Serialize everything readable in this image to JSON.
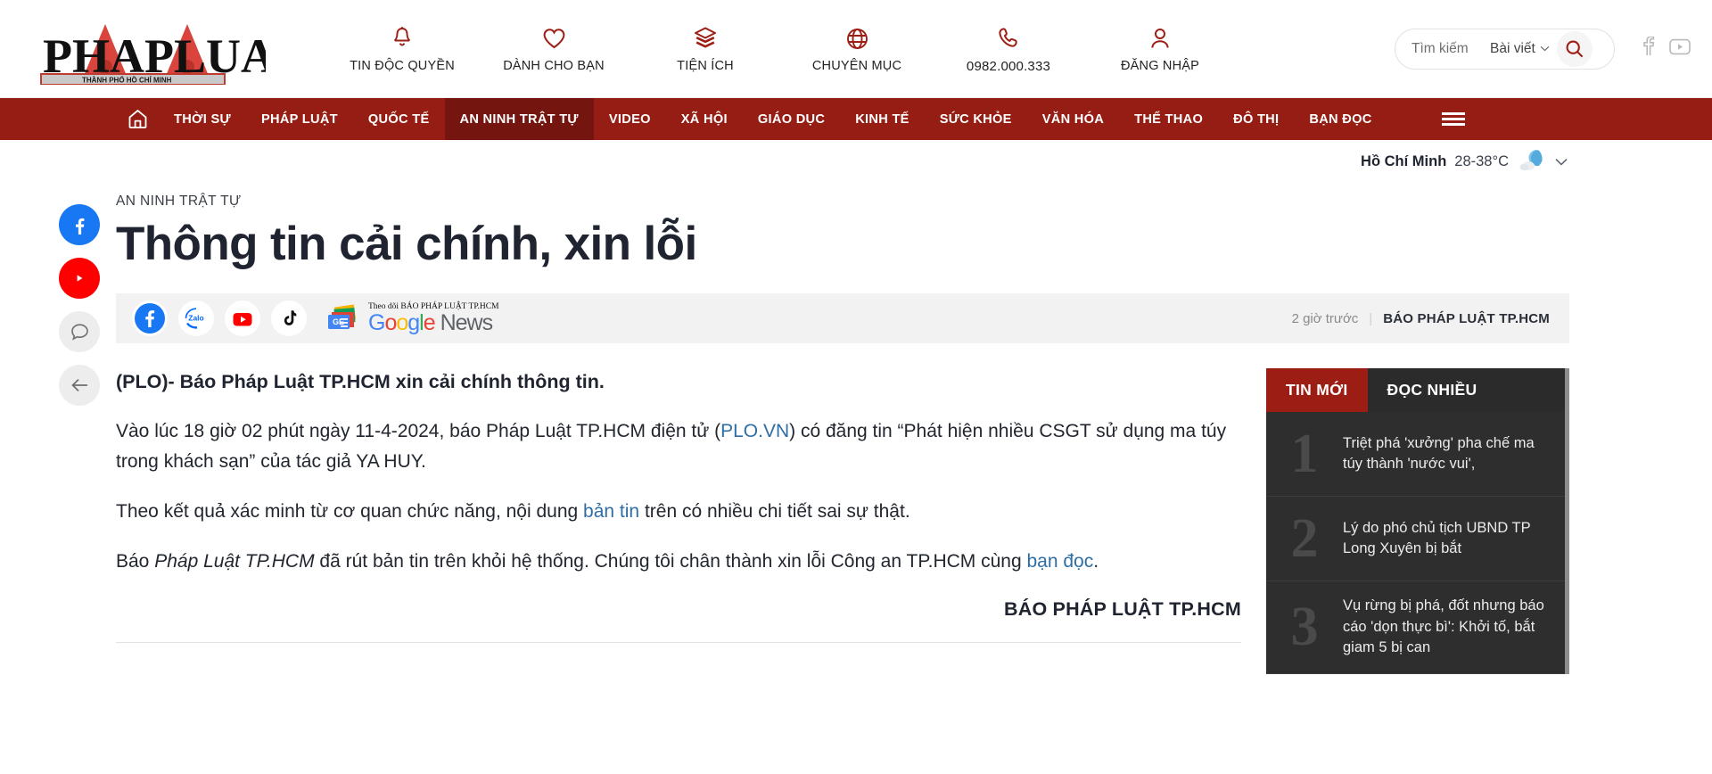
{
  "header": {
    "logo_main": "PHAPLUAT",
    "logo_sub": "THÀNH PHỐ HỒ CHÍ MINH",
    "nav_items": [
      {
        "label": "TIN ĐỘC QUYỀN",
        "icon": "bell-icon"
      },
      {
        "label": "DÀNH CHO BẠN",
        "icon": "heart-icon"
      },
      {
        "label": "TIỆN ÍCH",
        "icon": "layers-icon"
      },
      {
        "label": "CHUYÊN MỤC",
        "icon": "globe-icon"
      },
      {
        "label": "0982.000.333",
        "icon": "phone-icon"
      },
      {
        "label": "ĐĂNG NHẬP",
        "icon": "user-icon"
      }
    ],
    "search": {
      "placeholder": "Tìm kiếm",
      "value": "",
      "scope_label": "Bài viết",
      "button_icon": "search-icon"
    },
    "social": [
      {
        "name": "facebook-icon"
      },
      {
        "name": "youtube-icon"
      }
    ]
  },
  "mainnav": {
    "home_icon": "home-icon",
    "items": [
      {
        "label": "THỜI SỰ",
        "active": false
      },
      {
        "label": "PHÁP LUẬT",
        "active": false
      },
      {
        "label": "QUỐC TẾ",
        "active": false
      },
      {
        "label": "AN NINH TRẬT TỰ",
        "active": true
      },
      {
        "label": "VIDEO",
        "active": false
      },
      {
        "label": "XÃ HỘI",
        "active": false
      },
      {
        "label": "GIÁO DỤC",
        "active": false
      },
      {
        "label": "KINH TẾ",
        "active": false
      },
      {
        "label": "SỨC KHỎE",
        "active": false
      },
      {
        "label": "VĂN HÓA",
        "active": false
      },
      {
        "label": "THỂ THAO",
        "active": false
      },
      {
        "label": "ĐÔ THỊ",
        "active": false
      },
      {
        "label": "BẠN ĐỌC",
        "active": false
      }
    ],
    "menu_icon": "hamburger-icon",
    "accent_color": "#951d14",
    "active_color": "#74160f"
  },
  "weather": {
    "city": "Hồ Chí Minh",
    "temperature": "28-38°C",
    "icon": "moon-cloud-icon"
  },
  "rail": [
    {
      "name": "facebook-share",
      "icon": "facebook-icon",
      "color": "#1877f2"
    },
    {
      "name": "youtube-share",
      "icon": "youtube-icon",
      "color": "#ff0000"
    },
    {
      "name": "comment-button",
      "icon": "comment-icon",
      "color": "#ededed"
    },
    {
      "name": "back-button",
      "icon": "arrow-left-icon",
      "color": "#ededed"
    }
  ],
  "article": {
    "kicker": "AN NINH TRẬT TỰ",
    "headline": "Thông tin cải chính, xin lỗi",
    "share": {
      "buttons": [
        "facebook-icon",
        "zalo-icon",
        "youtube-icon",
        "tiktok-icon"
      ],
      "gnews_follow": "Theo dõi BÁO PHÁP LUẬT TP.HCM",
      "gnews_g": "G",
      "gnews_o1": "o",
      "gnews_o2": "o",
      "gnews_g2": "g",
      "gnews_l": "l",
      "gnews_e": "e",
      "gnews_news": "News",
      "gnews_badge": "GE"
    },
    "time_ago": "2 giờ trước",
    "separator": "|",
    "source": "BÁO PHÁP LUẬT TP.HCM",
    "lead": "(PLO)- Báo Pháp Luật TP.HCM xin cải chính thông tin.",
    "p1_a": "Vào lúc 18 giờ 02 phút ngày 11-4-2024, báo Pháp Luật TP.HCM điện tử (",
    "p1_link": "PLO.VN",
    "p1_b": ") có đăng tin “Phát hiện nhiều CSGT sử dụng ma túy trong khách sạn” của tác giả YA HUY.",
    "p2_a": "Theo kết quả xác minh từ cơ quan chức năng, nội dung ",
    "p2_link": "bản tin",
    "p2_b": " trên có nhiều chi tiết sai sự thật.",
    "p3_a": "Báo ",
    "p3_ital": "Pháp Luật TP.HCM",
    "p3_b": " đã rút bản tin trên khỏi hệ thống. Chúng tôi chân thành xin lỗi Công an TP.HCM cùng ",
    "p3_link": "bạn đọc",
    "p3_c": ".",
    "signoff": "BÁO PHÁP LUẬT TP.HCM"
  },
  "sidebar": {
    "tabs": [
      {
        "label": "TIN MỚI",
        "active": true
      },
      {
        "label": "ĐỌC NHIỀU",
        "active": false
      }
    ],
    "items": [
      {
        "rank": "1",
        "title": "Triệt phá 'xưởng' pha chế ma túy thành 'nước vui',"
      },
      {
        "rank": "2",
        "title": "Lý do phó chủ tịch UBND TP Long Xuyên bị bắt"
      },
      {
        "rank": "3",
        "title": "Vụ rừng bị phá, đốt nhưng báo cáo 'dọn thực bì': Khởi tố, bắt giam 5 bị can"
      }
    ]
  }
}
